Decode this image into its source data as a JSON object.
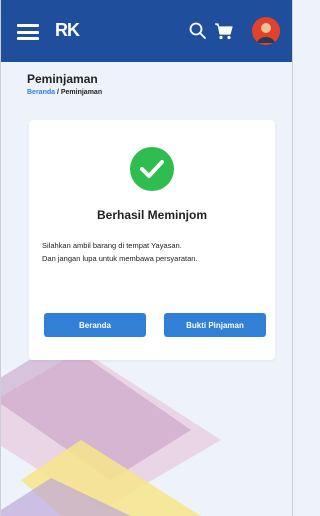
{
  "header": {
    "brand": "RK",
    "colors": {
      "topbar": "#1f4f9c",
      "accent": "#2f80d6",
      "success": "#2ebd4e"
    },
    "icons": [
      "menu-icon",
      "search-icon",
      "cart-icon",
      "avatar"
    ]
  },
  "page": {
    "title": "Peminjaman",
    "breadcrumb": {
      "home": "Beranda",
      "separator": " / ",
      "current": "Peminjaman"
    }
  },
  "card": {
    "status_icon": "check-circle-icon",
    "title": "Berhasil Meminjom",
    "message_line1": "Silahkan ambil barang di tempat Yayasan.",
    "message_line2": "Dan jangan lupa untuk membawa persyaratan.",
    "buttons": {
      "beranda": "Beranda",
      "bukti": "Bukti Pinjaman"
    }
  }
}
